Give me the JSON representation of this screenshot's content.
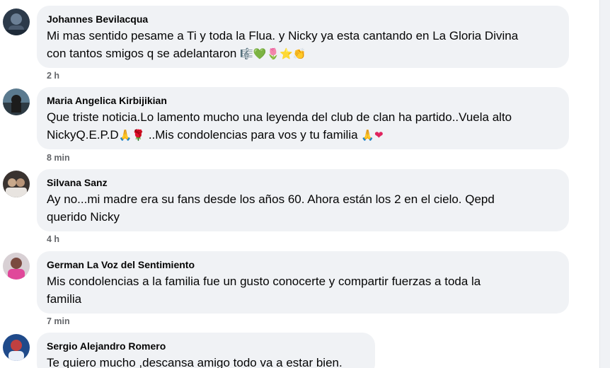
{
  "comments": [
    {
      "author": "Johannes Bevilacqua",
      "text_line1": "Mi mas sentido pesame a Ti y toda la Flua. y Nicky ya esta cantando en La Gloria Divina",
      "text_line2": "con tantos smigos q se adelantaron",
      "emojis": [
        "🎼",
        "💚",
        "🌷",
        "⭐",
        "👏"
      ],
      "time": "2 h"
    },
    {
      "author": "Maria Angelica Kirbijikian",
      "text_line1": "Que triste noticia.Lo lamento mucho una leyenda del club de clan ha partido..Vuela alto",
      "text_line2a": "NickyQ.E.P.D",
      "emojis_a": [
        "🙏",
        "🌹"
      ],
      "text_line2b": " ..Mis condolencias para vos y tu familia ",
      "emojis_b": [
        "🙏",
        "❤"
      ],
      "time": "8 min"
    },
    {
      "author": "Silvana Sanz",
      "text_line1": "Ay no...mi madre era su fans desde los años 60. Ahora están los 2 en el cielo. Qepd",
      "text_line2": "querido Nicky",
      "time": "4 h"
    },
    {
      "author": "German La Voz del Sentimiento",
      "text_line1": "Mis condolencias a la familia fue un gusto conocerte y compartir fuerzas a toda la",
      "text_line2": "familia",
      "time": "7 min"
    },
    {
      "author": "Sergio Alejandro Romero",
      "text_line1": "Te quiero mucho ,descansa amigo todo va a estar bien."
    }
  ],
  "colors": {
    "bubble_bg": "#f0f2f5",
    "author_text": "#050505",
    "timestamp_text": "#65676b"
  }
}
